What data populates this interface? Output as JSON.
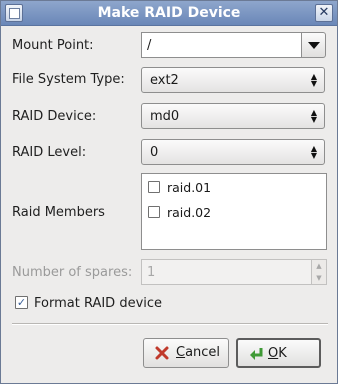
{
  "window": {
    "title": "Make RAID Device"
  },
  "form": {
    "mount_point": {
      "label": "Mount Point:",
      "value": "/"
    },
    "fs_type": {
      "label": "File System Type:",
      "value": "ext2"
    },
    "raid_device": {
      "label": "RAID Device:",
      "value": "md0"
    },
    "raid_level": {
      "label": "RAID Level:",
      "value": "0"
    },
    "raid_members": {
      "label": "Raid Members",
      "items": [
        {
          "label": "raid.01",
          "checked": false
        },
        {
          "label": "raid.02",
          "checked": false
        }
      ]
    },
    "spares": {
      "label": "Number of spares:",
      "value": "1",
      "enabled": false
    },
    "format": {
      "label": "Format RAID device",
      "checked": true
    }
  },
  "buttons": {
    "cancel": {
      "mnemonic": "C",
      "rest": "ancel"
    },
    "ok": {
      "mnemonic": "O",
      "rest": "K"
    }
  },
  "icons": [
    "window-menu-icon",
    "close-icon",
    "dropdown-arrow-icon",
    "spin-arrows-icon",
    "cancel-icon",
    "ok-icon"
  ],
  "colors": {
    "titlebar": "#7a96c3",
    "background": "#edeceb",
    "cancel_icon": "#c0392b",
    "ok_icon": "#3f9a36"
  }
}
